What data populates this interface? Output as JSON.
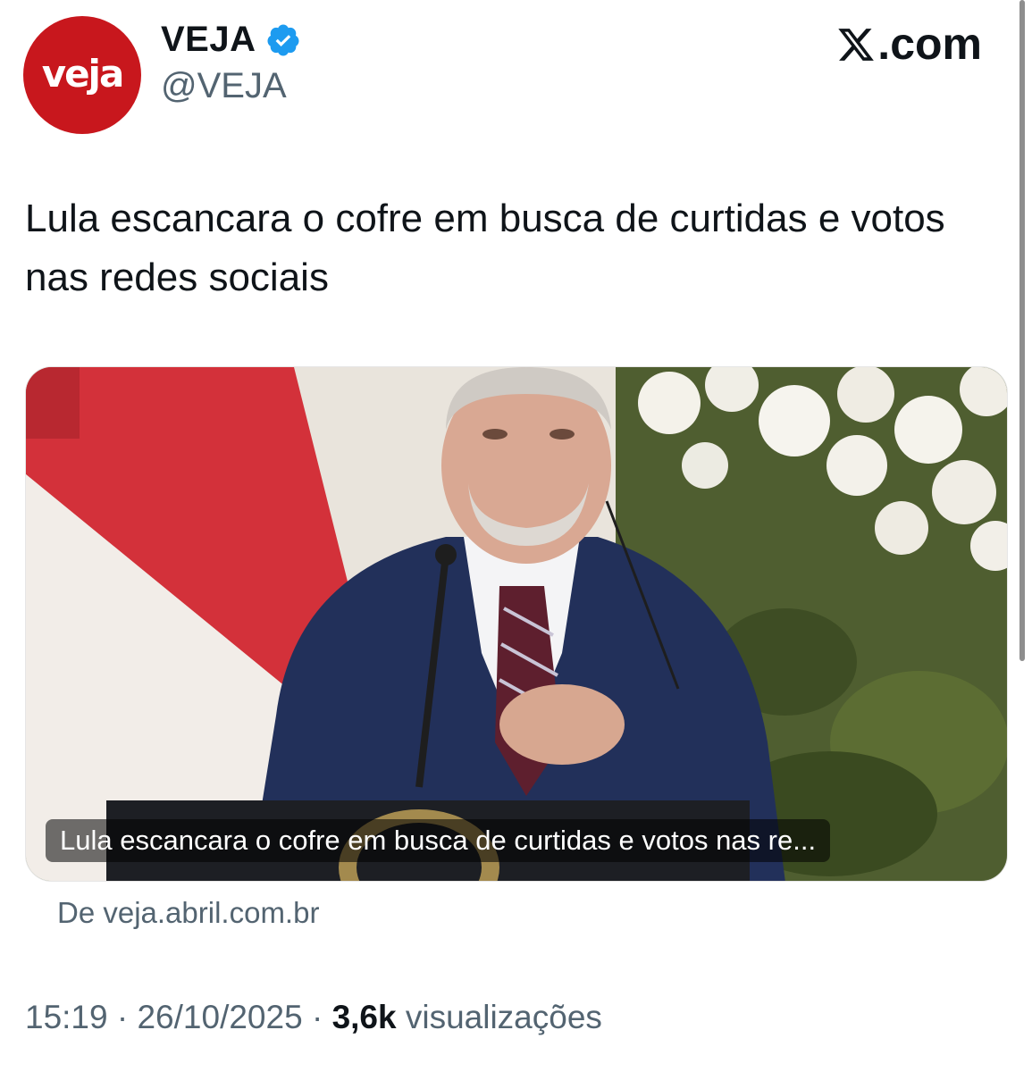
{
  "account": {
    "avatar_text": "veja",
    "display_name": "VEJA",
    "handle": "@VEJA",
    "verified_icon": "verified-badge-icon",
    "brand_color": "#c8171d",
    "verified_color": "#1d9bf0"
  },
  "watermark": {
    "text": ".com",
    "icon": "x-logo-icon"
  },
  "tweet": {
    "text": "Lula escancara o cofre em busca de curtidas e votos nas redes sociais"
  },
  "link_card": {
    "caption": "Lula escancara o cofre em busca de curtidas e votos nas re...",
    "source": "De veja.abril.com.br"
  },
  "meta": {
    "time": "15:19",
    "separator": "·",
    "date": "26/10/2025",
    "views_count": "3,6k",
    "views_label": "visualizações"
  }
}
